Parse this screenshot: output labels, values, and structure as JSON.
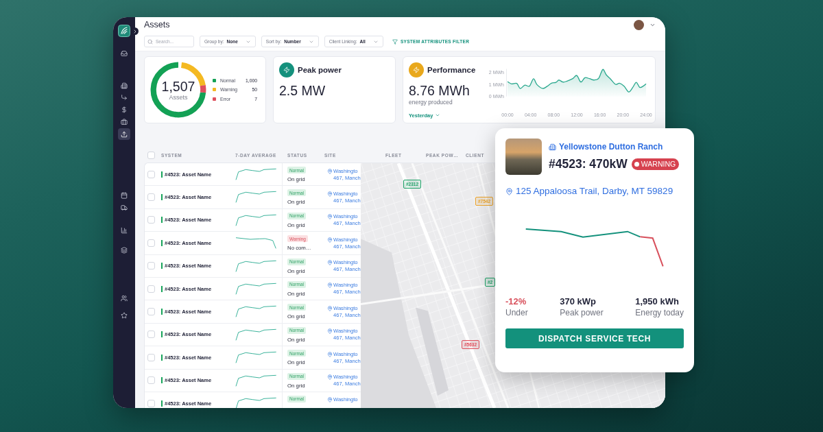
{
  "topbar": {
    "title": "Assets"
  },
  "sidebar": {
    "items": [
      {
        "selected": false
      },
      {
        "selected": false
      },
      {
        "selected": false
      },
      {
        "selected": false
      },
      {
        "selected": false
      },
      {
        "selected": true
      },
      {
        "selected": false
      },
      {
        "selected": false
      },
      {
        "selected": false
      },
      {
        "selected": false
      },
      {
        "selected": false
      },
      {
        "selected": false
      }
    ]
  },
  "filters": {
    "search": {
      "placeholder": "Search..."
    },
    "dropdowns": [
      {
        "label": "Group by:",
        "value": "None"
      },
      {
        "label": "Sort by:",
        "value": "Number"
      },
      {
        "label": "Client Linking:",
        "value": "All"
      }
    ],
    "attributes_filter": "SYSTEM ATTRIBUTES FILTER"
  },
  "summary": {
    "total": "1,507",
    "total_label": "Assets",
    "legend": [
      {
        "label": "Normal",
        "count": "1,000",
        "color": "#13a155"
      },
      {
        "label": "Warning",
        "count": "50",
        "color": "#f4b922"
      },
      {
        "label": "Error",
        "count": "7",
        "color": "#df4f5c"
      }
    ]
  },
  "peak_power": {
    "title": "Peak power",
    "value": "2.5 MW"
  },
  "performance": {
    "title": "Performance",
    "value": "8.76 MWh",
    "caption": "energy produced",
    "period": "Yesterday",
    "chart_data": {
      "type": "area",
      "x": [
        0,
        0.7,
        1.6,
        2.2,
        3,
        3.8,
        4.5,
        5.1,
        6.1,
        6.9,
        7.6,
        8.4,
        8.9,
        9.6,
        10.3,
        11.3,
        12,
        12.7,
        13.4,
        14.2,
        15,
        15.8,
        16.5,
        17.1,
        17.9,
        18.7,
        19.4,
        20.2,
        21,
        21.7,
        22.3,
        22.9,
        23.5,
        24
      ],
      "values": [
        1.24,
        1.05,
        1.09,
        0.67,
        0.95,
        0.86,
        1.47,
        0.99,
        0.67,
        0.86,
        1.1,
        1.18,
        1.37,
        1.2,
        1.28,
        1.49,
        1.75,
        1.2,
        1.56,
        1.49,
        1.37,
        1.52,
        2.25,
        1.81,
        1.43,
        1.01,
        1.1,
        0.86,
        0.38,
        0.76,
        1.18,
        0.76,
        0.86,
        1.05
      ],
      "xlim": [
        0,
        24
      ],
      "ylim": [
        0,
        2.3
      ],
      "xticks": [
        {
          "value": 0,
          "label": "00:00"
        },
        {
          "value": 4,
          "label": "04:00"
        },
        {
          "value": 8,
          "label": "08:00"
        },
        {
          "value": 12,
          "label": "12:00"
        },
        {
          "value": 16,
          "label": "16:00"
        },
        {
          "value": 20,
          "label": "20:00"
        },
        {
          "value": 24,
          "label": "24:00"
        }
      ],
      "yticks": [
        {
          "value": 0,
          "label": "0 MWh"
        },
        {
          "value": 1,
          "label": "1 MWh"
        },
        {
          "value": 2,
          "label": "2 MWh"
        }
      ]
    }
  },
  "table": {
    "header_checked": false,
    "columns": [
      "SYSTEM",
      "7-DAY AVERAGE",
      "STATUS",
      "SITE",
      "FLEET",
      "PEAK POW…",
      "CLIENT"
    ],
    "rows": [
      {
        "checked": false,
        "name": "#4523: Asset Name",
        "kind": "normal",
        "status": "Normal",
        "state": "On grid",
        "site": [
          "Washingto",
          "467, Manch"
        ]
      },
      {
        "checked": false,
        "name": "#4523: Asset Name",
        "kind": "normal",
        "status": "Normal",
        "state": "On grid",
        "site": [
          "Washingto",
          "467, Manch"
        ]
      },
      {
        "checked": false,
        "name": "#4523: Asset Name",
        "kind": "normal",
        "status": "Normal",
        "state": "On grid",
        "site": [
          "Washingto",
          "467, Manch"
        ]
      },
      {
        "checked": false,
        "name": "#4523: Asset Name",
        "kind": "warning",
        "status": "Warning",
        "state": "No com…",
        "site": [
          "Washingto",
          "467, Manch"
        ]
      },
      {
        "checked": false,
        "name": "#4523: Asset Name",
        "kind": "normal",
        "status": "Normal",
        "state": "On grid",
        "site": [
          "Washingto",
          "467, Manch"
        ]
      },
      {
        "checked": false,
        "name": "#4523: Asset Name",
        "kind": "normal",
        "status": "Normal",
        "state": "On grid",
        "site": [
          "Washingto",
          "467, Manch"
        ]
      },
      {
        "checked": false,
        "name": "#4523: Asset Name",
        "kind": "normal",
        "status": "Normal",
        "state": "On grid",
        "site": [
          "Washingto",
          "467, Manch"
        ]
      },
      {
        "checked": false,
        "name": "#4523: Asset Name",
        "kind": "normal",
        "status": "Normal",
        "state": "On grid",
        "site": [
          "Washingto",
          "467, Manch"
        ]
      },
      {
        "checked": false,
        "name": "#4523: Asset Name",
        "kind": "normal",
        "status": "Normal",
        "state": "On grid",
        "site": [
          "Washingto",
          "467, Manch"
        ]
      },
      {
        "checked": false,
        "name": "#4523: Asset Name",
        "kind": "normal",
        "status": "Normal",
        "state": "On grid",
        "site": [
          "Washingto",
          "467, Manch"
        ]
      },
      {
        "checked": false,
        "name": "#4523: Asset Name",
        "kind": "normal",
        "status": "Normal",
        "site": [
          "Washingto"
        ]
      }
    ]
  },
  "map": {
    "pins": [
      {
        "label": "#2312",
        "color": "#22a36a"
      },
      {
        "label": "#7542",
        "color": "#eda52c"
      },
      {
        "label": "#2",
        "color": "#22a36a"
      },
      {
        "label": "#5632",
        "color": "#df4f5c"
      }
    ]
  },
  "popup": {
    "site": "Yellowstone Dutton Ranch",
    "title": "#4523: 470kW",
    "badge": {
      "label": "WARNING",
      "kind": "warning"
    },
    "address": "125 Appaloosa Trail, Darby, MT 59829",
    "stats": [
      {
        "value": "-12%",
        "label": "Under",
        "kind": "negative"
      },
      {
        "value": "370 kWp",
        "label": "Peak power",
        "kind": "neutral"
      },
      {
        "value": "1,950 kWh",
        "label": "Energy today",
        "kind": "neutral"
      }
    ],
    "action": "DISPATCH SERVICE TECH"
  }
}
